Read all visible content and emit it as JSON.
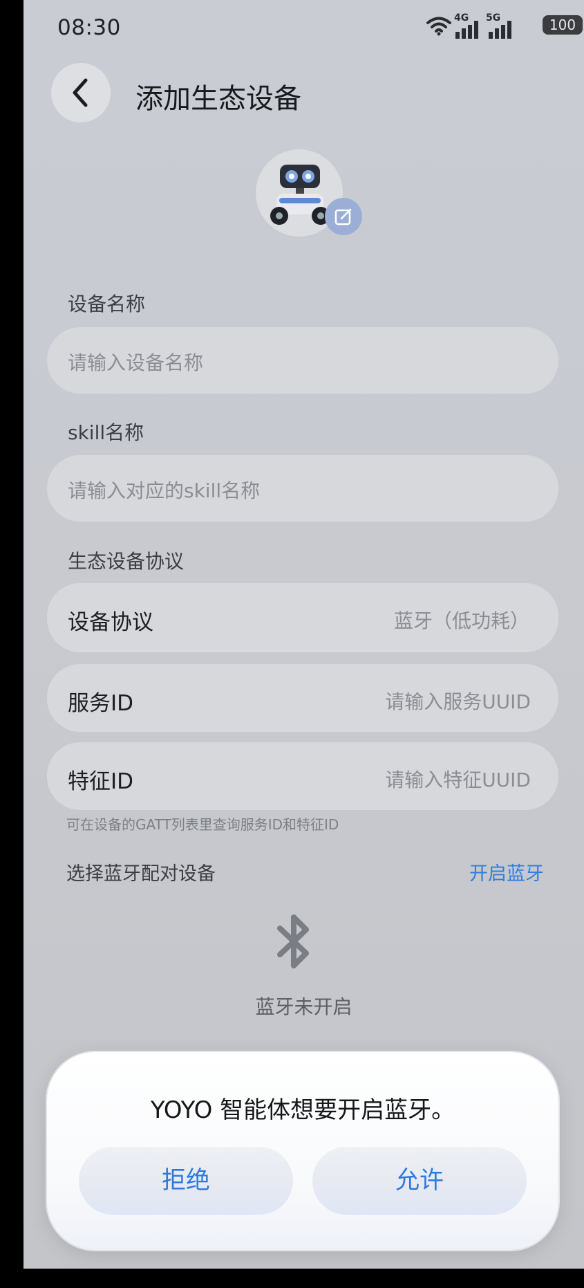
{
  "status_bar": {
    "time": "08:30",
    "net1": "4G",
    "net2": "5G",
    "battery": "100"
  },
  "header": {
    "title": "添加生态设备",
    "back_icon": "chevron-left-icon"
  },
  "device_name": {
    "label": "设备名称",
    "placeholder": "请输入设备名称"
  },
  "skill_name": {
    "label": "skill名称",
    "placeholder": "请输入对应的skill名称"
  },
  "protocol_section": {
    "label": "生态设备协议",
    "protocol_row": {
      "label": "设备协议",
      "value": "蓝牙（低功耗）"
    },
    "service_row": {
      "label": "服务ID",
      "placeholder": "请输入服务UUID"
    },
    "characteristic_row": {
      "label": "特征ID",
      "placeholder": "请输入特征UUID"
    },
    "hint": "可在设备的GATT列表里查询服务ID和特征ID"
  },
  "bluetooth": {
    "title": "选择蓝牙配对设备",
    "enable_link": "开启蓝牙",
    "status": "蓝牙未开启",
    "icon": "bluetooth-icon"
  },
  "dialog": {
    "message": "YOYO 智能体想要开启蓝牙。",
    "deny": "拒绝",
    "allow": "允许"
  },
  "colors": {
    "accent": "#2e7de0",
    "background": "#c9ccd3",
    "field": "#d7d8dc"
  }
}
